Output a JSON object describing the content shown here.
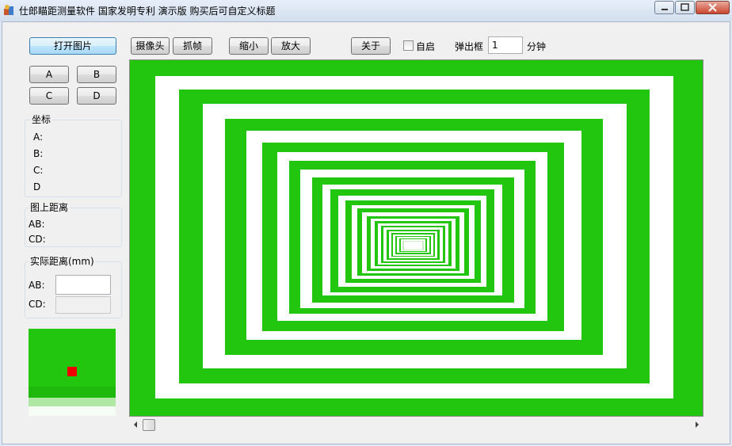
{
  "window": {
    "title": "仕郎瞄距测量软件 国家发明专利 演示版 购买后可自定义标题"
  },
  "toolbar": {
    "open_image": "打开图片",
    "camera": "摄像头",
    "grab_frame": "抓帧",
    "zoom_out": "缩小",
    "zoom_in": "放大",
    "about": "关于",
    "auto_start_label": "自启",
    "auto_start_checked": false,
    "popup_label": "弹出框",
    "popup_value": "1",
    "minutes_label": "分钟"
  },
  "points": {
    "a": "A",
    "b": "B",
    "c": "C",
    "d": "D"
  },
  "coords_group": {
    "title": "坐标",
    "a": "A:",
    "b": "B:",
    "c": "C:",
    "d": "D"
  },
  "image_distance_group": {
    "title": "图上距离",
    "ab": "AB:",
    "cd": "CD:"
  },
  "real_distance_group": {
    "title": "实际距离(mm)",
    "ab": "AB:",
    "ab_value": "",
    "cd": "CD:",
    "cd_value": ""
  },
  "colors": {
    "pattern_green": "#22c60e",
    "pattern_white": "#ffffff",
    "marker_red": "#ee0000"
  }
}
